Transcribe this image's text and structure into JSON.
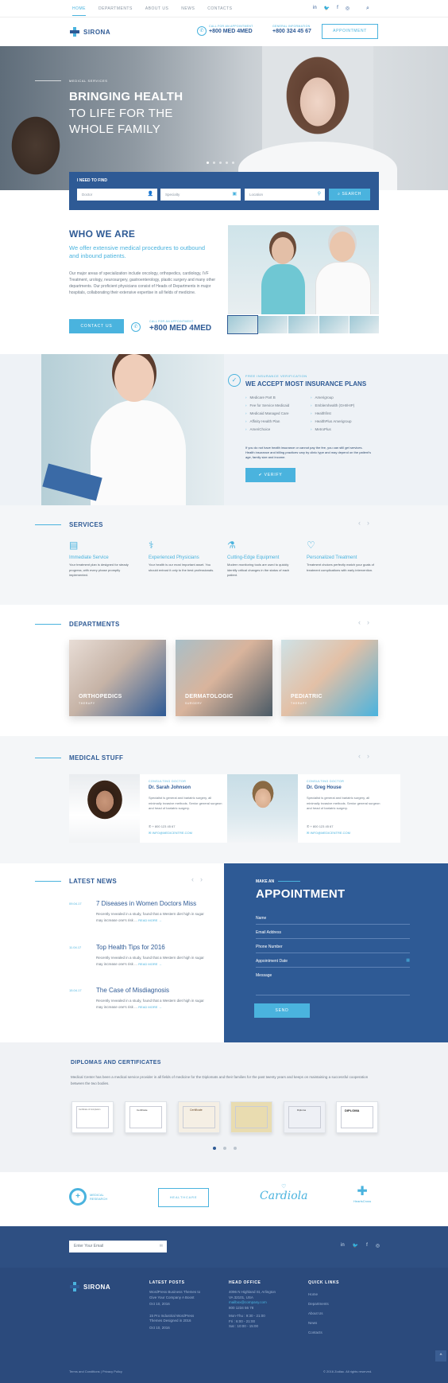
{
  "nav": {
    "items": [
      "HOME",
      "DEPARTMENTS",
      "ABOUT US",
      "NEWS",
      "CONTACTS"
    ],
    "social": [
      "in",
      "🐦",
      "f",
      "◎"
    ],
    "search_icon": "search-icon"
  },
  "header": {
    "logo": "SIRONA",
    "call_label": "CALL FOR AN APPOINTMENT",
    "call_number": "+800 MED 4MED",
    "info_label": "GENERAL INFORMATION",
    "info_number": "+800 324 45 67",
    "appointment_button": "APPOINTMENT"
  },
  "hero": {
    "eyebrow": "MEDICAL SERVICES",
    "title_line1": "BRINGING HEALTH",
    "title_line2": "TO LIFE FOR THE",
    "title_line3": "WHOLE FAMILY",
    "slides": 5,
    "active_slide": 1
  },
  "find": {
    "label": "I NEED TO FIND",
    "doctor_placeholder": "Doctor",
    "specialty_placeholder": "Specialty",
    "location_placeholder": "Location",
    "search_button": "SEARCH"
  },
  "who": {
    "title": "WHO WE ARE",
    "subtitle": "We offer extensive medical procedures to outbound and inbound patients.",
    "body": "Our major areas of specialization include oncology, orthopedics, cardiology, IVF Treatment, urology, neurosurgery, gastroenterology, plastic surgery and many other departments. Our proficient physicians consist of Heads of Departments in major hospitals, collaborating their extensive expertise in all fields of medicine.",
    "contact_button": "CONTACT US",
    "call_label": "CALL FOR AN APPOINTMENT",
    "call_number": "+800 MED 4MED"
  },
  "insurance": {
    "eyebrow": "FREE INSURANCE VERIFICATION",
    "title": "WE ACCEPT MOST INSURANCE PLANS",
    "plans": [
      "Medicare Part B",
      "Amerigroup",
      "Fee for Service Medicaid",
      "Emblemhealth (GHI/HIP)",
      "Medicaid Managed Care",
      "Healthfirst",
      "Affinity Health Plan",
      "HealthPlus Amerigroup",
      "AmeriChoice",
      "MetroPlus"
    ],
    "note": "If you do not have health insurance or cannot pay the fee, you can still get services. Health insurance and billing practices vary by clinic type and may depend on the patient's age, family size and income.",
    "verify_button": "VERIFY"
  },
  "services": {
    "title": "SERVICES",
    "items": [
      {
        "icon": "clipboard-icon",
        "title": "Immediate Service",
        "desc": "Your treatment plan is designed for steady progress, with every phase promptly implemented."
      },
      {
        "icon": "doctor-icon",
        "title": "Experienced Physicians",
        "desc": "Your health is our most important asset. You should entrust it only to the best professionals."
      },
      {
        "icon": "microscope-icon",
        "title": "Cutting-Edge Equipment",
        "desc": "Modern monitoring tools are used to quickly identify critical changes in the status of each patient."
      },
      {
        "icon": "heart-icon",
        "title": "Personalized Treatment",
        "desc": "Treatment choices perfectly match your goals of treatment complications with early intervention."
      }
    ]
  },
  "departments": {
    "title": "DEPARTMENTS",
    "items": [
      {
        "name": "ORTHOPEDICS",
        "sub": "THERAPY",
        "color": "#2e5a95"
      },
      {
        "name": "DERMATOLOGIC",
        "sub": "SURGERY",
        "color": "#4a5a66"
      },
      {
        "name": "PEDIATRIC",
        "sub": "THERAPY",
        "color": "#4ab3de"
      }
    ]
  },
  "staff": {
    "title": "MEDICAL STUFF",
    "doctors": [
      {
        "role": "CONSULTING DOCTOR",
        "name": "Dr. Sarah Johnson",
        "bio": "Specialist is general and bariatric surgery, all minimally invasive methods. Senior general surgeon and head of bariatric surgery.",
        "phone": "+ 800 123 45 67",
        "email": "INFO@MEDICENTRE.COM"
      },
      {
        "role": "CONSULTING DOCTOR",
        "name": "Dr. Greg House",
        "bio": "Specialist is general and bariatric surgery, all minimally invasive methods. Senior general surgeon and head of bariatric surgery.",
        "phone": "+ 800 123 45 67",
        "email": "INFO@MEDICENTRE.COM"
      }
    ]
  },
  "news": {
    "title": "LATEST NEWS",
    "items": [
      {
        "date": "09.04.17",
        "title": "7 Diseases in Women Doctors Miss",
        "excerpt": "Recently revealed in a study, found that a Western diet high in sugar may increase one's risk ...",
        "more": "READ MORE →"
      },
      {
        "date": "11.04.17",
        "title": "Top Health Tips for 2016",
        "excerpt": "Recently revealed in a study, found that a Western diet high in sugar may increase one's risk ...",
        "more": "READ MORE →"
      },
      {
        "date": "15.04.17",
        "title": "The Case of Misdiagnosis",
        "excerpt": "Recently revealed in a study, found that a Western diet high in sugar may increase one's risk ...",
        "more": "READ MORE →"
      }
    ]
  },
  "appointment": {
    "eyebrow": "MAKE AN",
    "title": "APPOINTMENT",
    "fields": [
      "Name",
      "Email Address",
      "Phone Number",
      "Appointment Date",
      "Message"
    ],
    "send_button": "SEND"
  },
  "diplomas": {
    "title": "DIPLOMAS AND CERTIFICATES",
    "text": "Medical Center has been a medical service provider in all fields of medicine for the Diplomats and their families for the past twenty years and keeps on maintaining a successful cooperation between the two bodies.",
    "count": 6,
    "labels": [
      "Certificate of Completion",
      "Certificate",
      "Certificate",
      "",
      "Diploma",
      "DIPLOMA"
    ]
  },
  "partners": [
    {
      "name": "MEDICAL RESEARCH",
      "icon": "cross-circle-icon"
    },
    {
      "name": "HEALTHCARE",
      "icon": "health-box-icon"
    },
    {
      "name": "Cardiola",
      "icon": "heart-icon"
    },
    {
      "name": "HeartsCross",
      "icon": "hearts-cross-icon"
    }
  ],
  "newsletter": {
    "placeholder": "Enter Your Email",
    "social": [
      "in",
      "🐦",
      "f",
      "◎"
    ]
  },
  "footer": {
    "logo": "SIRONA",
    "latest_posts_title": "LATEST POSTS",
    "posts": [
      {
        "title": "WordPress Business Themes to Give Your Company A Boost",
        "date": "Oct 10, 2016"
      },
      {
        "title": "15 Pro Industrial WordPress Themes Designed in 2016",
        "date": "Oct 10, 2016"
      }
    ],
    "office_title": "HEAD OFFICE",
    "office": [
      "4096 N Highland St, Arlington",
      "VA 32101, USA",
      "",
      "mailbox@company.com",
      "800 1234 56 78",
      "",
      "Mon-Thu : 9:30 - 21:00",
      "Fri : 6:00 - 21:00",
      "Sat : 10:00 - 15:00"
    ],
    "links_title": "QUICK LINKS",
    "links": [
      "Home",
      "Departments",
      "About Us",
      "News",
      "Contacts"
    ],
    "terms": "Terms and Conditions",
    "privacy": "Privacy Policy",
    "copyright": "© 2016 Zodiac. All rights reserved.",
    "scroll_top": "^"
  }
}
